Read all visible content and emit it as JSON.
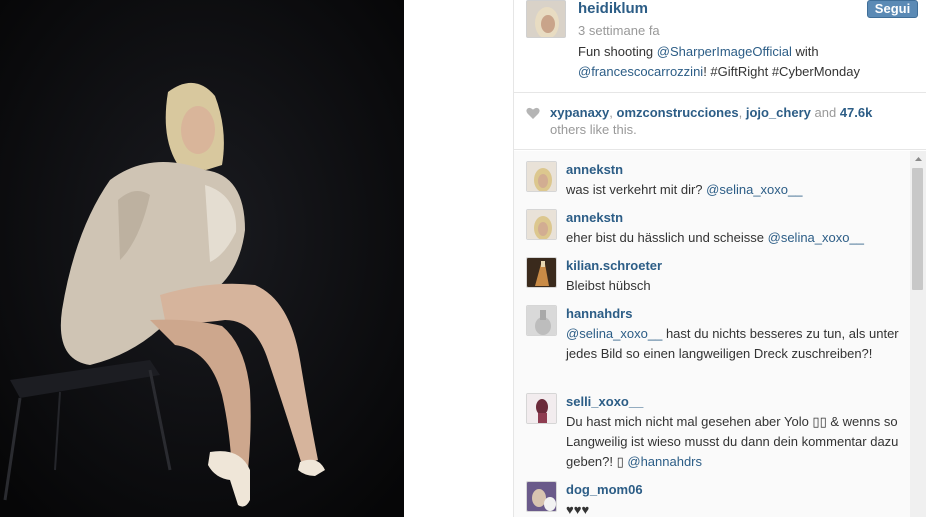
{
  "post": {
    "username": "heidiklum",
    "timestamp": "3 settimane fa",
    "follow_label": "Segui",
    "caption_parts": [
      {
        "text": "Fun shooting ",
        "type": "text"
      },
      {
        "text": "@SharperImageOfficial",
        "type": "mention"
      },
      {
        "text": " with ",
        "type": "text"
      },
      {
        "text": "@francescocarrozzini",
        "type": "mention"
      },
      {
        "text": "! #GiftRight #CyberMonday",
        "type": "text"
      }
    ]
  },
  "likes": {
    "user1": "xypanaxy",
    "user2": "omzconstrucciones",
    "user3": "jojo_chery",
    "and_label": "and",
    "count": "47.6k",
    "suffix": "others like this."
  },
  "comments": [
    {
      "user": "annekstn",
      "parts": [
        {
          "text": "was ist verkehrt mit dir? ",
          "type": "text"
        },
        {
          "text": "@selina_xoxo__",
          "type": "mention"
        }
      ]
    },
    {
      "user": "annekstn",
      "parts": [
        {
          "text": "eher bist du hässlich und scheisse ",
          "type": "text"
        },
        {
          "text": "@selina_xoxo__",
          "type": "mention"
        }
      ]
    },
    {
      "user": "kilian.schroeter",
      "parts": [
        {
          "text": "Bleibst hübsch",
          "type": "text"
        }
      ]
    },
    {
      "user": "hannahdrs",
      "parts": [
        {
          "text": "@selina_xoxo__",
          "type": "mention"
        },
        {
          "text": " hast du nichts besseres zu tun, als unter jedes Bild so einen langweiligen Dreck zuschreiben?!",
          "type": "text"
        }
      ]
    },
    {
      "user": "selli_xoxo__",
      "parts": [
        {
          "text": "Du hast mich nicht mal gesehen aber Yolo ▯▯ & wenns so Langweilig ist wieso musst du dann dein kommentar dazu geben?! ▯ ",
          "type": "text"
        },
        {
          "text": "@hannahdrs",
          "type": "mention"
        }
      ]
    },
    {
      "user": "dog_mom06",
      "parts": [
        {
          "text": "♥♥♥",
          "type": "text"
        }
      ]
    }
  ],
  "colors": {
    "link": "#2c5d86",
    "follow_button": "#5b8ab5",
    "photo_background": "#0b0b0d"
  }
}
